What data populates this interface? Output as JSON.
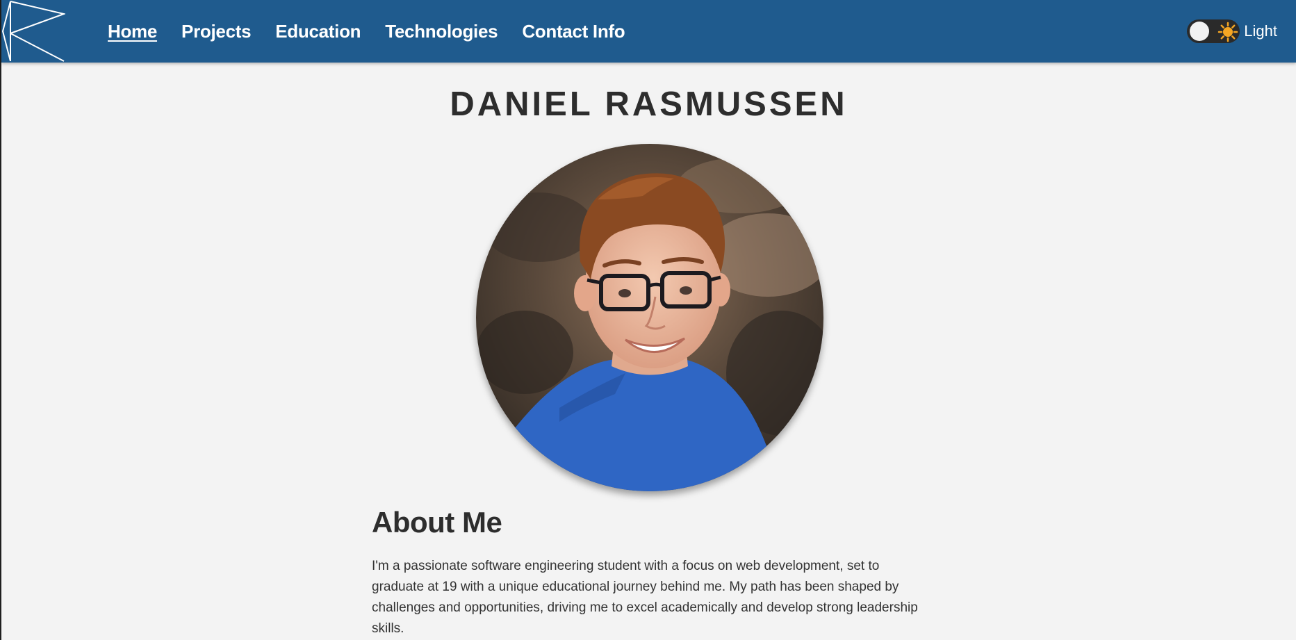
{
  "nav": {
    "items": [
      {
        "label": "Home",
        "active": true
      },
      {
        "label": "Projects",
        "active": false
      },
      {
        "label": "Education",
        "active": false
      },
      {
        "label": "Technologies",
        "active": false
      },
      {
        "label": "Contact Info",
        "active": false
      }
    ],
    "theme_label": "Light",
    "theme_toggle_icon": "sun-icon"
  },
  "hero": {
    "name": "DANIEL RASMUSSEN",
    "photo_icon": "profile-photo"
  },
  "about": {
    "heading": "About Me",
    "text": "I'm a passionate software engineering student with a focus on web development, set to graduate at 19 with a unique educational journey behind me. My path has been shaped by challenges and opportunities, driving me to excel academically and develop strong leadership skills."
  },
  "colors": {
    "header_bg": "#1f5b8e",
    "page_bg": "#f3f3f3",
    "text": "#2d2d2d",
    "sun": "#f5a623"
  }
}
